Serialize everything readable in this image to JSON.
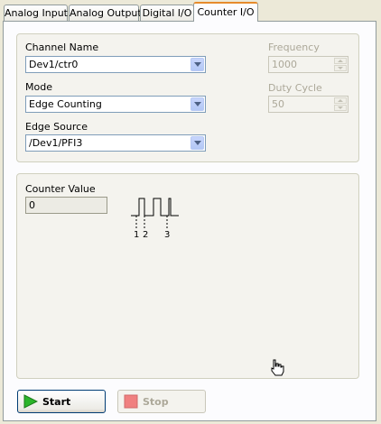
{
  "tabs": [
    "Analog Input",
    "Analog Output",
    "Digital I/O",
    "Counter I/O"
  ],
  "channel": {
    "label": "Channel Name",
    "value": "Dev1/ctr0"
  },
  "mode": {
    "label": "Mode",
    "value": "Edge Counting"
  },
  "edge_source": {
    "label": "Edge Source",
    "value": "/Dev1/PFI3"
  },
  "frequency": {
    "label": "Frequency",
    "value": "1000"
  },
  "duty_cycle": {
    "label": "Duty Cycle",
    "value": "50"
  },
  "counter": {
    "label": "Counter Value",
    "value": "0",
    "edge_labels": [
      "1",
      "2",
      "3"
    ]
  },
  "buttons": {
    "start": "Start",
    "stop": "Stop"
  },
  "colors": {
    "active_tab_accent": "#e68b2c",
    "start_icon": "#2bb52b",
    "stop_icon": "#f08080"
  }
}
